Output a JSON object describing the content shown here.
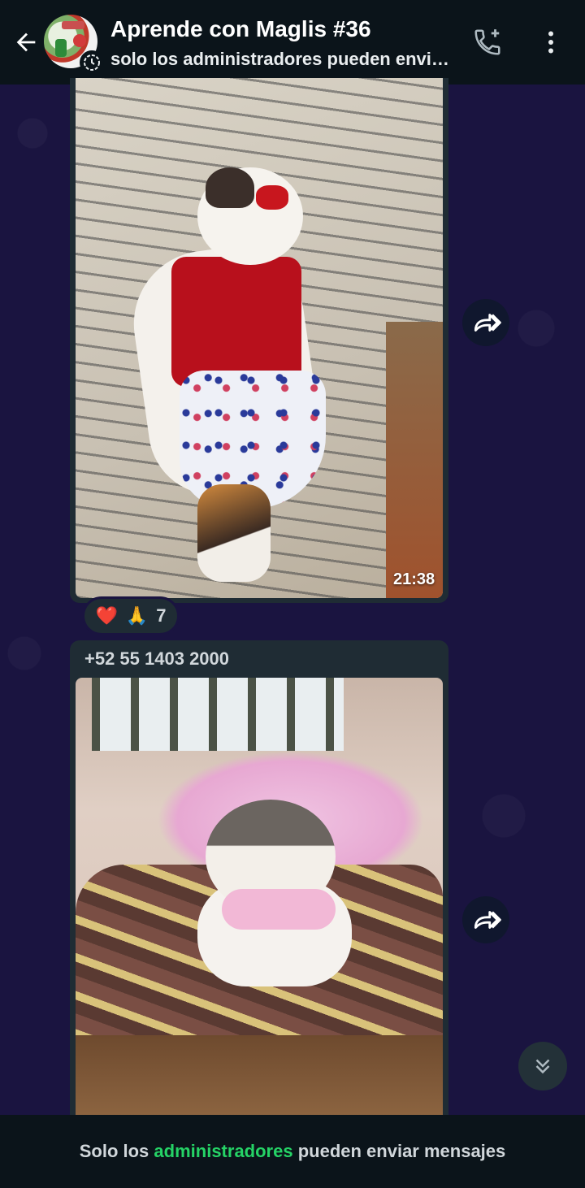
{
  "header": {
    "title": "Aprende con Maglis #36",
    "subtitle": "solo los administradores pueden envi…",
    "icons": {
      "back": "arrow-left-icon",
      "call": "add-call-icon",
      "menu": "more-vertical-icon",
      "community": "community-badge-icon"
    }
  },
  "messages": [
    {
      "type": "image",
      "image_description": "",
      "time": "21:38",
      "reactions": {
        "emojis": [
          "❤️",
          "🙏"
        ],
        "count": "7"
      }
    },
    {
      "type": "image",
      "sender": "+52 55 1403 2000"
    }
  ],
  "footer": {
    "prefix": "Solo los ",
    "link": "administradores",
    "suffix": " pueden enviar mensajes"
  },
  "colors": {
    "header_bg": "#0b141a",
    "chat_bg": "#1a1440",
    "bubble_bg": "#1f2c34",
    "accent_green": "#25d366"
  }
}
